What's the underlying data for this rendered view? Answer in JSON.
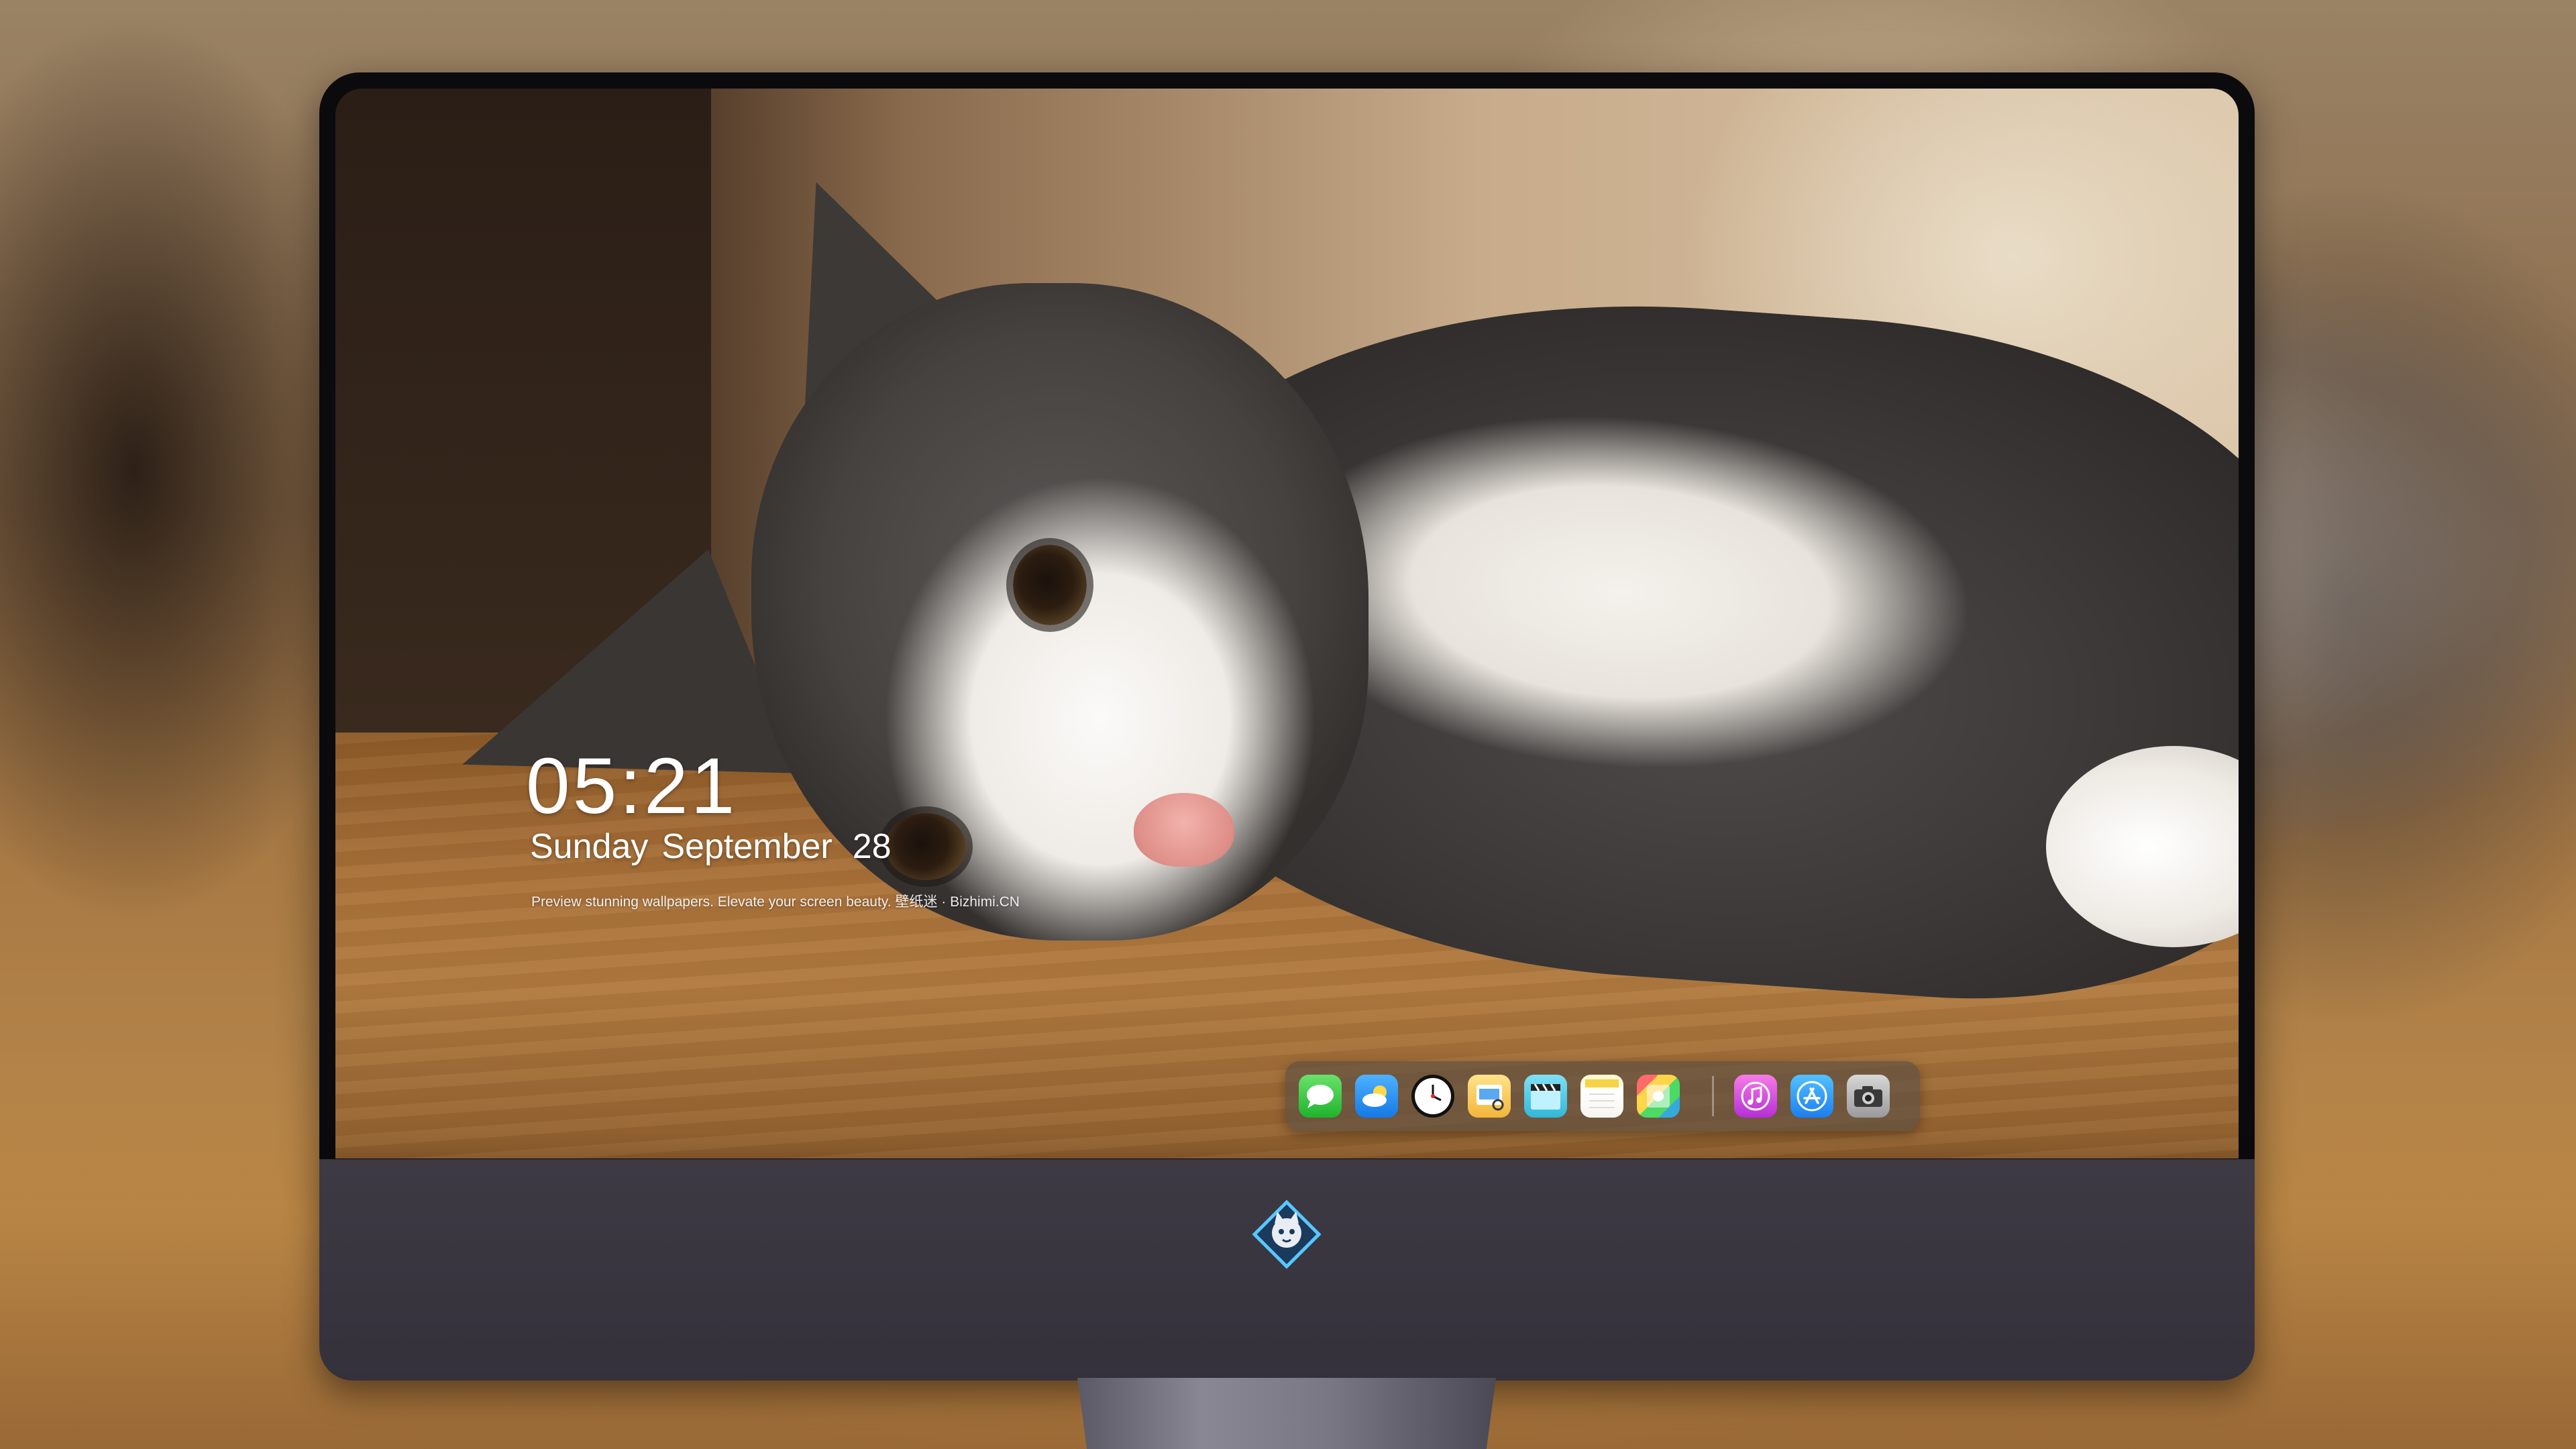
{
  "lock_screen": {
    "time": "05:21",
    "date_day": "Sunday",
    "date_month": "September",
    "date_num": "28",
    "tagline": "Preview stunning wallpapers. Elevate your screen beauty. 壁纸迷 · Bizhimi.CN"
  },
  "dock": {
    "apps": [
      {
        "name": "messages-icon"
      },
      {
        "name": "weather-icon"
      },
      {
        "name": "clock-icon"
      },
      {
        "name": "preview-icon"
      },
      {
        "name": "clips-icon"
      },
      {
        "name": "notes-icon"
      },
      {
        "name": "photo-booth-icon"
      },
      {
        "name": "music-icon"
      },
      {
        "name": "app-store-icon"
      },
      {
        "name": "camera-icon"
      }
    ]
  },
  "monitor": {
    "logo": "cat-mascot-logo"
  },
  "colors": {
    "text": "#ffffff",
    "bezel": "#0b0b0d",
    "chin": "#3d3a44"
  }
}
